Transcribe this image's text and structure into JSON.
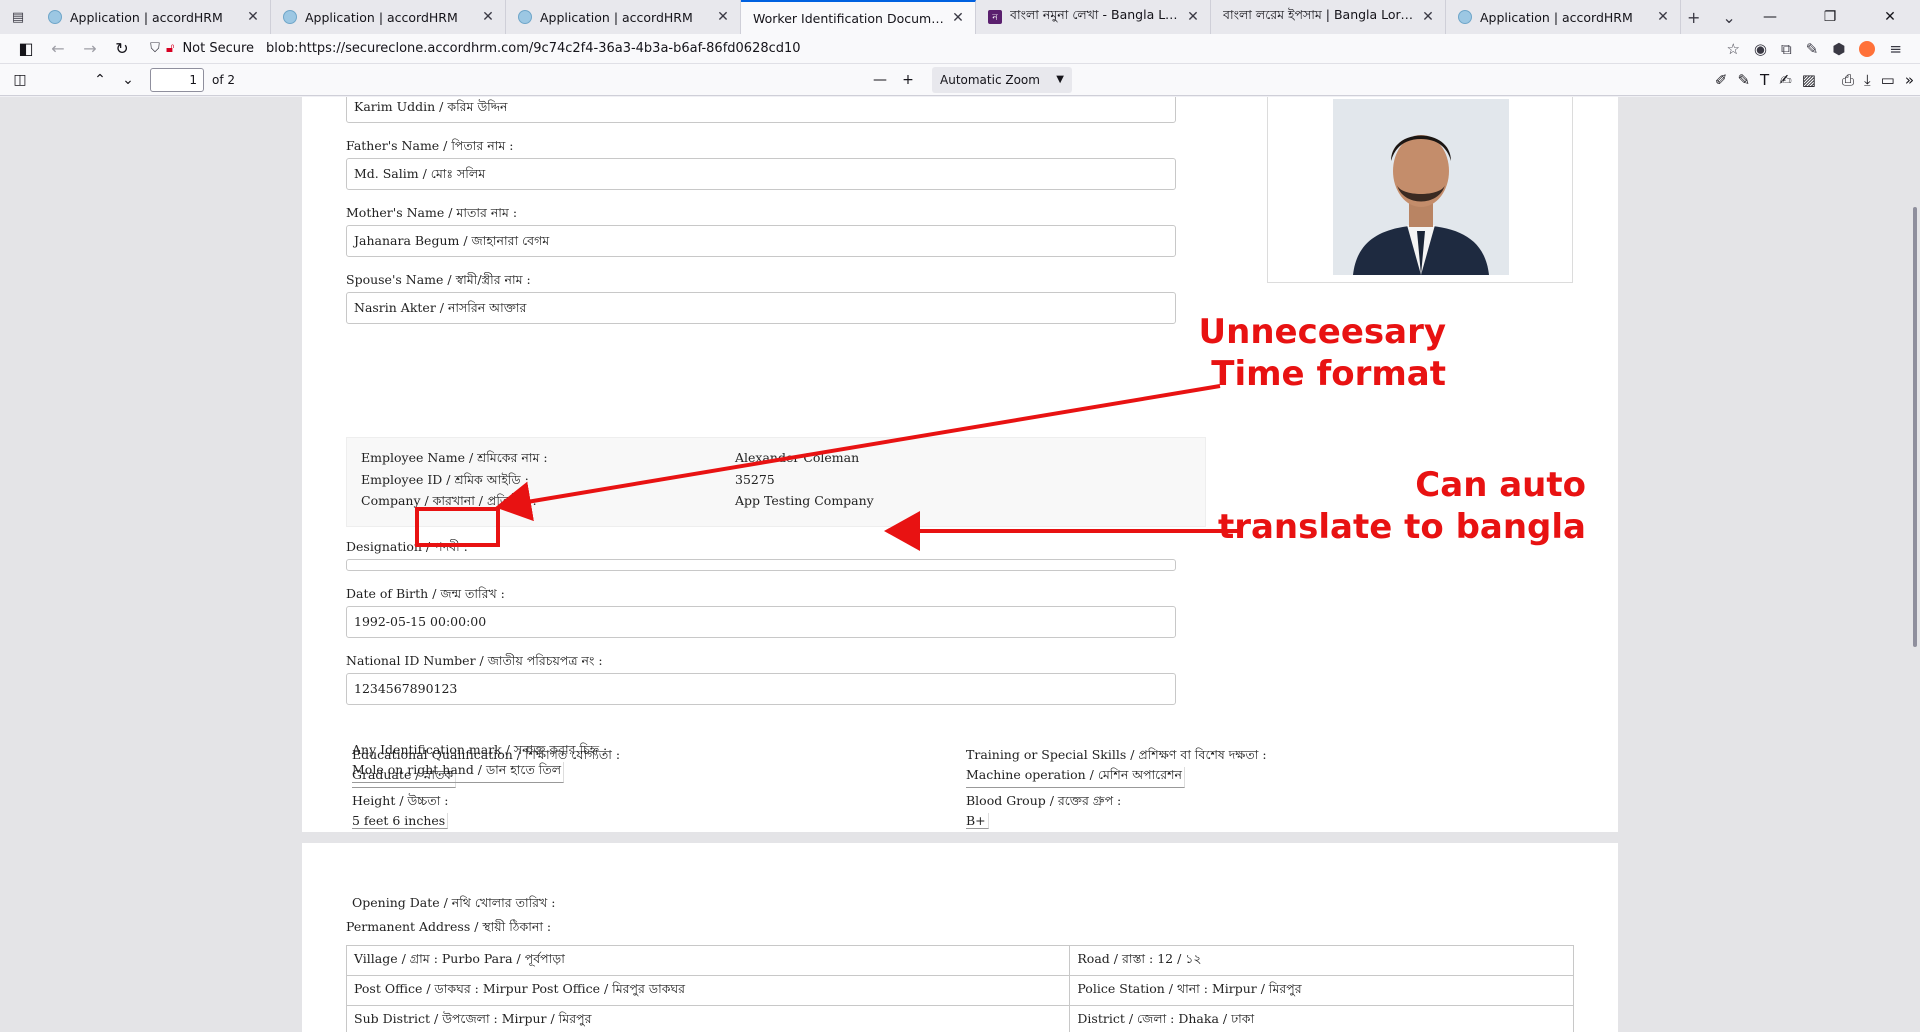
{
  "browser": {
    "tabs": [
      {
        "title": "Application | accordHRM",
        "icon": "globe"
      },
      {
        "title": "Application | accordHRM",
        "icon": "globe"
      },
      {
        "title": "Application | accordHRM",
        "icon": "globe"
      },
      {
        "title": "Worker Identification Document - Emp",
        "icon": "doc",
        "active": true
      },
      {
        "title": "বাংলা নমুনা লেখা - Bangla Lorem I",
        "icon": "bn",
        "icon_letter": "ন"
      },
      {
        "title": "বাংলা লরেম ইপসাম | Bangla Lorem Ip",
        "icon": "none"
      },
      {
        "title": "Application | accordHRM",
        "icon": "globe"
      }
    ],
    "security_label": "Not Secure",
    "url": "blob:https://secureclone.accordhrm.com/9c74c2f4-36a3-4b3a-b6af-86fd0628cd10"
  },
  "pdf_toolbar": {
    "page_number": "1",
    "page_count": "of 2",
    "zoom": "Automatic Zoom"
  },
  "document": {
    "top_name_value": "Karim Uddin / করিম উদ্দিন",
    "fathers_name_label": "Father's Name / পিতার নাম :",
    "fathers_name_value": "Md. Salim / মোঃ সলিম",
    "mothers_name_label": "Mother's Name / মাতার নাম :",
    "mothers_name_value": "Jahanara Begum / জাহানারা বেগম",
    "spouse_name_label": "Spouse's Name / স্বামী/স্ত্রীর নাম :",
    "spouse_name_value": "Nasrin Akter / নাসরিন আক্তার",
    "employee_info": {
      "name_label": "Employee Name / শ্রমিকের নাম :",
      "name_value": "Alexander Coleman",
      "id_label": "Employee ID / শ্রমিক আইডি :",
      "id_value": "35275",
      "company_label": "Company / কারখানা / প্রতিষ্ঠান :",
      "company_value": "App Testing Company"
    },
    "designation_label": "Designation / পদবী :",
    "designation_value": "",
    "dob_label": "Date of Birth / জন্ম তারিখ :",
    "dob_value": "1992-05-15 00:00:00",
    "nid_label": "National ID Number / জাতীয় পরিচয়পত্র নং :",
    "nid_value": "1234567890123",
    "education_label": "Educational Qualification / শিক্ষাগত যোগ্যতা :",
    "education_value": "Graduate / স্নাতক",
    "training_label": "Training or Special Skills / প্রশিক্ষণ বা বিশেষ দক্ষতা :",
    "training_value": "Machine operation / মেশিন অপারেশন",
    "height_label": "Height / উচ্চতা :",
    "height_value": "5 feet 6 inches",
    "blood_label": "Blood Group / রক্তের গ্রুপ :",
    "blood_value": "B+",
    "idmark_label": "Any Identification mark / সনাক্ত করার চিহ্ন :",
    "idmark_value": "Mole on right hand / ডান হাতে তিল",
    "opening_date_label": "Opening Date / নথি খোলার তারিখ :",
    "permanent_address_label": "Permanent Address / স্থায়ী ঠিকানা :",
    "address_rows": [
      [
        "Village / গ্রাম : Purbo Para / পূর্বপাড়া",
        "Road / রাস্তা : 12 / ১২"
      ],
      [
        "Post Office / ডাকঘর : Mirpur Post Office / মিরপুর ডাকঘর",
        "Police Station / থানা : Mirpur / মিরপুর"
      ],
      [
        "Sub District / উপজেলা : Mirpur / মিরপুর",
        "District / জেলা : Dhaka / ঢাকা"
      ]
    ]
  },
  "annotations": {
    "note1_line1": "Unneceesary",
    "note1_line2": "Time format",
    "note2_line1": "Can auto",
    "note2_line2": "translate to bangla",
    "color": "#e81212"
  }
}
